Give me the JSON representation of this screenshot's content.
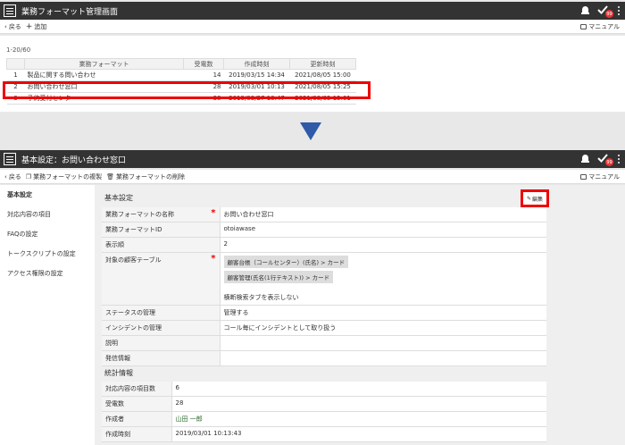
{
  "screen1": {
    "title": "業務フォーマット管理画面",
    "badge": "99",
    "toolbar": {
      "back": "戻る",
      "add": "追加",
      "manual": "マニュアル"
    },
    "count": "1-20/60",
    "columns": [
      "",
      "業務フォーマット",
      "受電数",
      "作成時刻",
      "更新時刻"
    ],
    "rows": [
      {
        "no": "1",
        "name": "製品に関する問い合わせ",
        "count": "14",
        "created": "2019/03/15 14:34",
        "updated": "2021/08/05 15:00"
      },
      {
        "no": "2",
        "name": "お問い合わせ窓口",
        "count": "28",
        "created": "2019/03/01 10:13",
        "updated": "2021/08/05 15:25"
      },
      {
        "no": "3",
        "name": "予約受付センター",
        "count": "38",
        "created": "2019/03/27 10:47",
        "updated": "2021/08/05 15:01"
      }
    ]
  },
  "screen2": {
    "title": "基本設定：お問い合わせ窓口",
    "badge": "99",
    "toolbar": {
      "back": "戻る",
      "copy": "業務フォーマットの複製",
      "delete": "業務フォーマットの削除",
      "manual": "マニュアル"
    },
    "nav": [
      "基本設定",
      "対応内容の項目",
      "FAQの設定",
      "トークスクリプトの設定",
      "アクセス権限の設定"
    ],
    "basic": {
      "title": "基本設定",
      "edit": "編集",
      "rows": [
        {
          "label": "業務フォーマットの名称",
          "value": "お問い合わせ窓口"
        },
        {
          "label": "業務フォーマットID",
          "value": "otoiawase"
        },
        {
          "label": "表示順",
          "value": "2"
        },
        {
          "label": "対象の顧客テーブル",
          "tags": [
            "顧客台帳（コールセンター）(氏名) > カード",
            "顧客管理(氏名(1行テキスト)) > カード"
          ],
          "note": "横断検索タブを表示しない"
        },
        {
          "label": "ステータスの管理",
          "value": "管理する"
        },
        {
          "label": "インシデントの管理",
          "value": "コール毎にインシデントとして取り扱う"
        },
        {
          "label": "説明",
          "value": ""
        },
        {
          "label": "発信情報",
          "value": ""
        }
      ]
    },
    "stats": {
      "title": "統計情報",
      "rows": [
        {
          "label": "対応内容の項目数",
          "value": "6"
        },
        {
          "label": "受電数",
          "value": "28"
        },
        {
          "label": "作成者",
          "value": "山田 一郎"
        },
        {
          "label": "作成時刻",
          "value": "2019/03/01 10:13:43"
        }
      ]
    }
  },
  "colors": {
    "accent_red": "#e00000",
    "arrow_blue": "#2e5aa8",
    "titlebar": "#333333"
  }
}
